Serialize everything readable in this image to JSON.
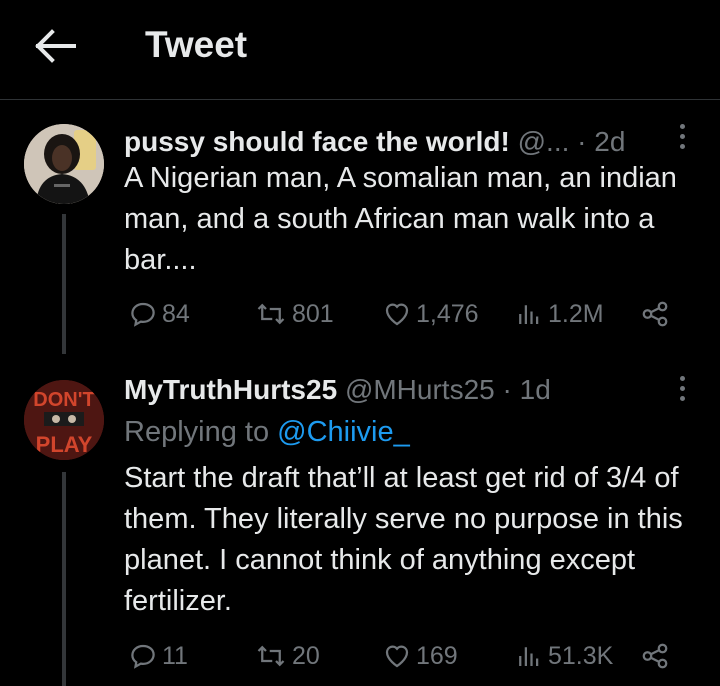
{
  "header": {
    "title": "Tweet",
    "back_icon": "arrow-left-icon"
  },
  "tweets": [
    {
      "display_name": "pussy should face the world!",
      "handle": "@...",
      "time": "· 2d",
      "text": "A Nigerian man, A somalian man, an indian man, and a south African man walk into a bar....",
      "stats": {
        "replies": "84",
        "retweets": "801",
        "likes": "1,476",
        "views": "1.2M"
      }
    },
    {
      "display_name": "MyTruthHurts25",
      "handle": "@MHurts25",
      "time": "· 1d",
      "replying_prefix": "Replying to",
      "replying_to": "@Chiivie_",
      "avatar_text_top": "DON'T",
      "avatar_text_bottom": "PLAY",
      "text": "Start the draft that’ll at least get rid of 3/4 of them. They literally serve no purpose in this planet. I cannot think of anything except fertilizer.",
      "stats": {
        "replies": "11",
        "retweets": "20",
        "likes": "169",
        "views": "51.3K"
      }
    }
  ],
  "colors": {
    "background": "#000000",
    "text": "#e7e9ea",
    "muted": "#71767b",
    "link": "#1d9bf0"
  }
}
